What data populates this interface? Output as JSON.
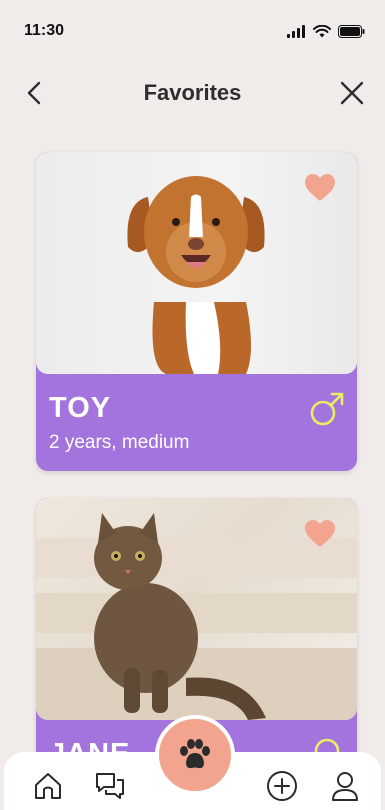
{
  "status_bar": {
    "time": "11:30",
    "icons": [
      "signal-icon",
      "wifi-icon",
      "battery-icon"
    ]
  },
  "header": {
    "title": "Favorites",
    "back_icon": "chevron-left-icon",
    "close_icon": "close-icon"
  },
  "favorites": [
    {
      "name": "TOY",
      "details": "2 years, medium",
      "gender": "male",
      "favorited": true,
      "photo": "dog-photo"
    },
    {
      "name": "JANE",
      "details": "",
      "gender": "female",
      "favorited": true,
      "photo": "cat-photo"
    }
  ],
  "tab_bar": {
    "items": [
      "home-icon",
      "chat-icon",
      "paw-icon",
      "add-circle-icon",
      "profile-icon"
    ],
    "active": "paw-icon"
  },
  "colors": {
    "background": "#f1ecea",
    "card_accent": "#a374dd",
    "heart": "#f2a48f",
    "gender_icon": "#e9ee63",
    "fab": "#f2a48f"
  }
}
